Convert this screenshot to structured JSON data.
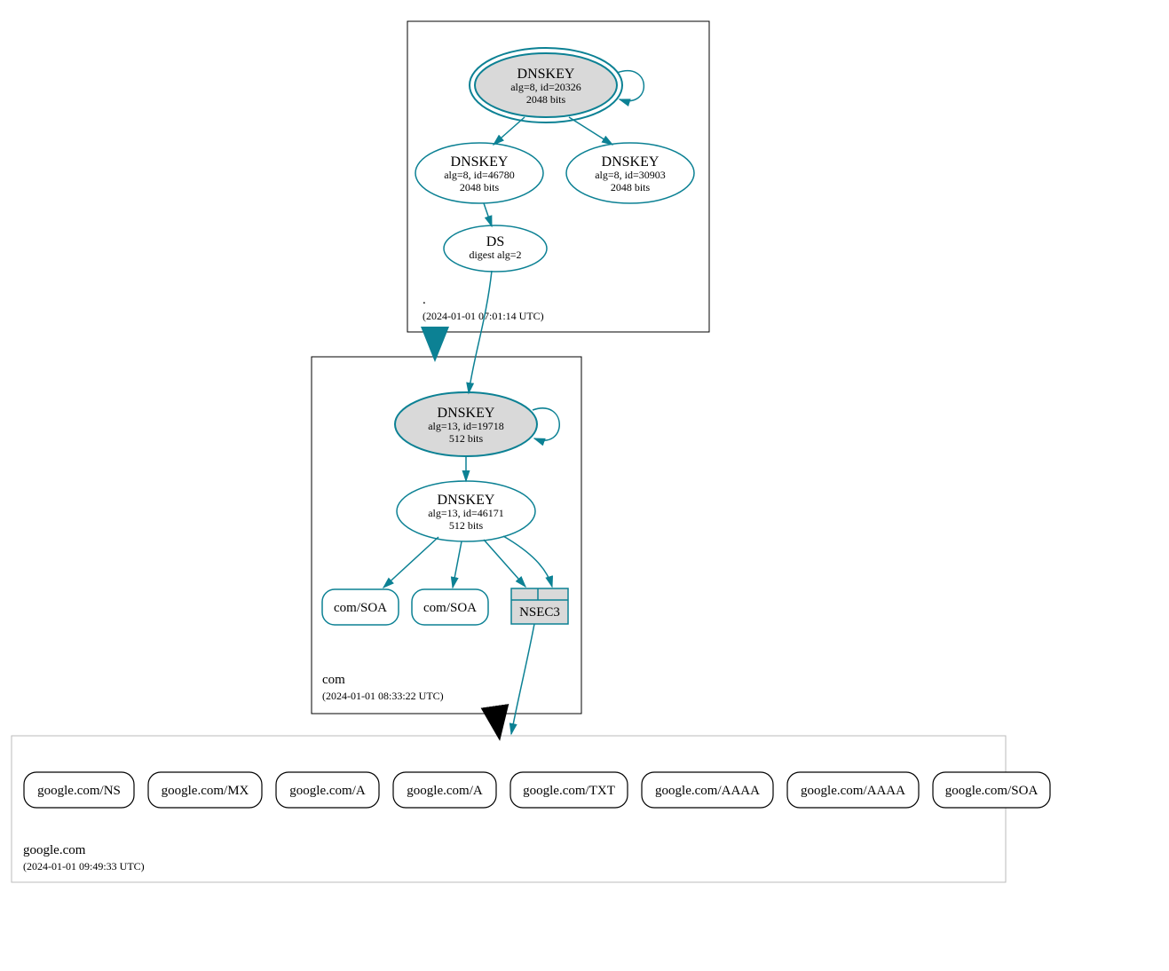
{
  "zones": {
    "root": {
      "label": ".",
      "timestamp": "(2024-01-01 07:01:14 UTC)"
    },
    "com": {
      "label": "com",
      "timestamp": "(2024-01-01 08:33:22 UTC)"
    },
    "google": {
      "label": "google.com",
      "timestamp": "(2024-01-01 09:49:33 UTC)"
    }
  },
  "nodes": {
    "root_ksk": {
      "title": "DNSKEY",
      "line2": "alg=8, id=20326",
      "line3": "2048 bits"
    },
    "root_zsk1": {
      "title": "DNSKEY",
      "line2": "alg=8, id=46780",
      "line3": "2048 bits"
    },
    "root_zsk2": {
      "title": "DNSKEY",
      "line2": "alg=8, id=30903",
      "line3": "2048 bits"
    },
    "root_ds": {
      "title": "DS",
      "line2": "digest alg=2"
    },
    "com_ksk": {
      "title": "DNSKEY",
      "line2": "alg=13, id=19718",
      "line3": "512 bits"
    },
    "com_zsk": {
      "title": "DNSKEY",
      "line2": "alg=13, id=46171",
      "line3": "512 bits"
    },
    "com_soa1": {
      "label": "com/SOA"
    },
    "com_soa2": {
      "label": "com/SOA"
    },
    "com_nsec3": {
      "label": "NSEC3"
    },
    "gc": [
      "google.com/NS",
      "google.com/MX",
      "google.com/A",
      "google.com/A",
      "google.com/TXT",
      "google.com/AAAA",
      "google.com/AAAA",
      "google.com/SOA"
    ]
  }
}
